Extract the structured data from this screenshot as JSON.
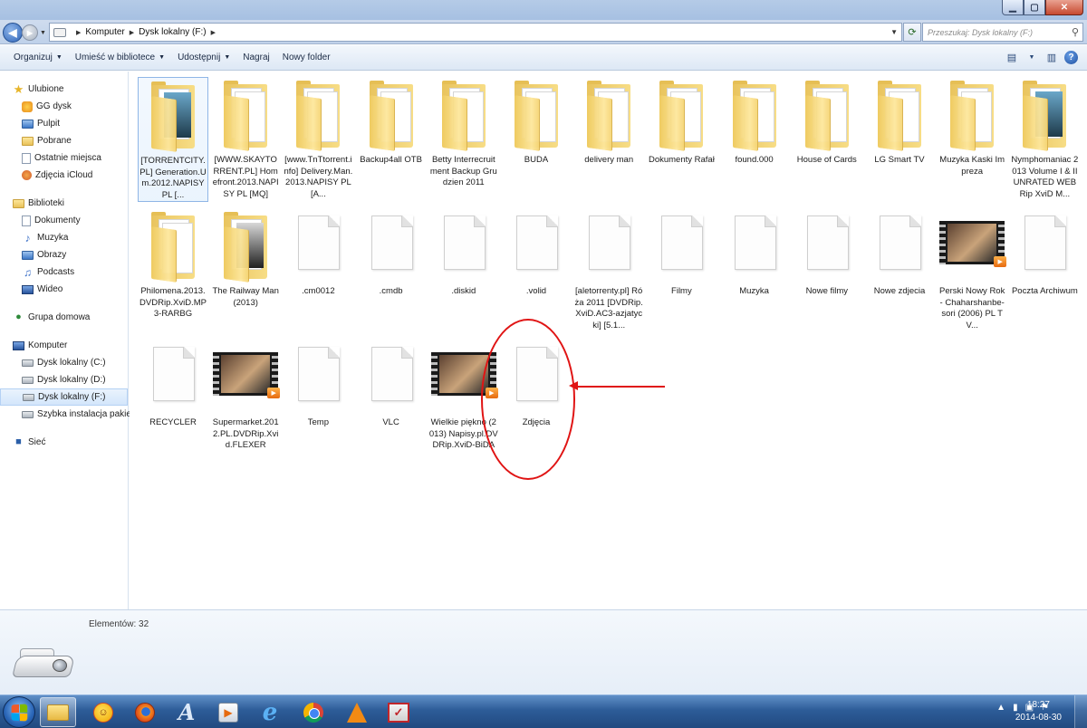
{
  "address": {
    "crumbs": [
      "Komputer",
      "Dysk lokalny (F:)"
    ],
    "search_placeholder": "Przeszukaj: Dysk lokalny (F:)"
  },
  "toolbar": {
    "organize": "Organizuj",
    "library": "Umieść w bibliotece",
    "share": "Udostępnij",
    "burn": "Nagraj",
    "new_folder": "Nowy folder"
  },
  "nav": {
    "favorites": {
      "label": "Ulubione",
      "items": [
        "GG dysk",
        "Pulpit",
        "Pobrane",
        "Ostatnie miejsca",
        "Zdjęcia iCloud"
      ]
    },
    "libraries": {
      "label": "Biblioteki",
      "items": [
        "Dokumenty",
        "Muzyka",
        "Obrazy",
        "Podcasts",
        "Wideo"
      ]
    },
    "homegroup": "Grupa domowa",
    "computer": {
      "label": "Komputer",
      "items": [
        "Dysk lokalny (C:)",
        "Dysk lokalny (D:)",
        "Dysk lokalny (F:)",
        "Szybka instalacja pakietu"
      ]
    },
    "network": "Sieć"
  },
  "files": [
    {
      "name": "[TORRENTCITY.PL] Generation.Um.2012.NAPISY PL [...",
      "kind": "folder-thumb"
    },
    {
      "name": "[WWW.SKAYTORRENT.PL] Homefront.2013.NAPISY PL [MQ]",
      "kind": "folder-paper"
    },
    {
      "name": "[www.TnTtorrent.info] Delivery.Man.2013.NAPISY PL [A...",
      "kind": "folder-paper"
    },
    {
      "name": "Backup4all OTB",
      "kind": "folder-paper"
    },
    {
      "name": "Betty Interrecruitment Backup Grudzien 2011",
      "kind": "folder-paper"
    },
    {
      "name": "BUDA",
      "kind": "folder-paper"
    },
    {
      "name": "delivery man",
      "kind": "folder-paper"
    },
    {
      "name": "Dokumenty Rafał",
      "kind": "folder-paper"
    },
    {
      "name": "found.000",
      "kind": "folder-paper"
    },
    {
      "name": "House of Cards",
      "kind": "folder-paper"
    },
    {
      "name": "LG Smart TV",
      "kind": "folder-paper"
    },
    {
      "name": "Muzyka Kaski Impreza",
      "kind": "folder-paper"
    },
    {
      "name": "Nymphomaniac 2013 Volume I & II UNRATED WEBRip XviD M...",
      "kind": "folder-thumb"
    },
    {
      "name": "Philomena.2013.DVDRip.XviD.MP3-RARBG",
      "kind": "folder-paper"
    },
    {
      "name": "The Railway Man (2013)",
      "kind": "folder-thumb"
    },
    {
      "name": ".cm0012",
      "kind": "blank"
    },
    {
      "name": ".cmdb",
      "kind": "blank"
    },
    {
      "name": ".diskid",
      "kind": "blank"
    },
    {
      "name": ".volid",
      "kind": "blank"
    },
    {
      "name": "[aletorrenty.pl] Róża 2011 [DVDRip.XviD.AC3-azjatycki] [5.1...",
      "kind": "blank"
    },
    {
      "name": "Filmy",
      "kind": "blank"
    },
    {
      "name": "Muzyka",
      "kind": "blank"
    },
    {
      "name": "Nowe filmy",
      "kind": "blank"
    },
    {
      "name": "Nowe zdjecia",
      "kind": "blank"
    },
    {
      "name": "Perski Nowy Rok - Chaharshanbe-sori (2006) PL TV...",
      "kind": "video"
    },
    {
      "name": "Poczta Archiwum",
      "kind": "blank"
    },
    {
      "name": "RECYCLER",
      "kind": "blank"
    },
    {
      "name": "Supermarket.2012.PL.DVDRip.Xvid.FLEXER",
      "kind": "video"
    },
    {
      "name": "Temp",
      "kind": "blank"
    },
    {
      "name": "VLC",
      "kind": "blank"
    },
    {
      "name": "Wielkie piękno (2013) Napisy.pl.DVDRip.XviD-BiDA",
      "kind": "video"
    },
    {
      "name": "Zdjęcia",
      "kind": "blank"
    }
  ],
  "details": {
    "count": "Elementów: 32"
  },
  "clock": {
    "time": "18:27",
    "date": "2014-08-30"
  },
  "colors": {
    "accent": "#2d5c98",
    "annotation": "#e01414",
    "folder": "#f0cc62"
  }
}
